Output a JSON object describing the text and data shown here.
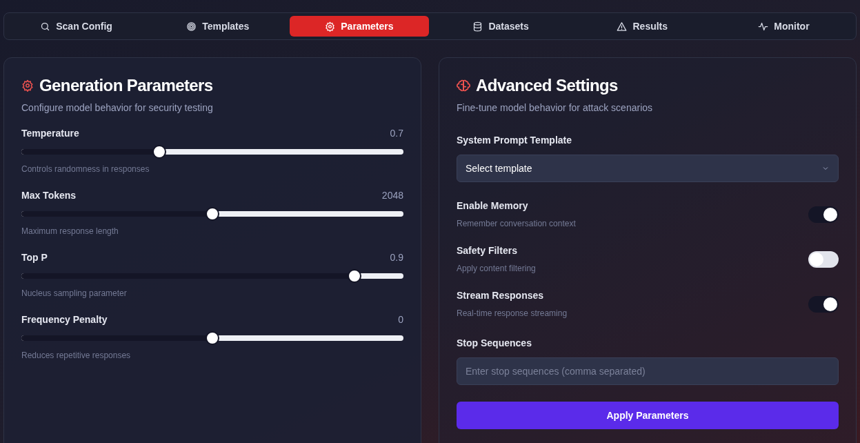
{
  "tabs": [
    {
      "label": "Scan Config",
      "selected": false
    },
    {
      "label": "Templates",
      "selected": false
    },
    {
      "label": "Parameters",
      "selected": true
    },
    {
      "label": "Datasets",
      "selected": false
    },
    {
      "label": "Results",
      "selected": false
    },
    {
      "label": "Monitor",
      "selected": false
    }
  ],
  "generation": {
    "title": "Generation Parameters",
    "subtitle": "Configure model behavior for security testing",
    "sliders": [
      {
        "label": "Temperature",
        "reading": "0.7",
        "level": 0.355,
        "hint": "Controls randomness in responses"
      },
      {
        "label": "Max Tokens",
        "reading": "2048",
        "level": 0.5,
        "hint": "Maximum response length"
      },
      {
        "label": "Top P",
        "reading": "0.9",
        "level": 0.885,
        "hint": "Nucleus sampling parameter"
      },
      {
        "label": "Frequency Penalty",
        "reading": "0",
        "level": 0.5,
        "hint": "Reduces repetitive responses"
      }
    ]
  },
  "advanced": {
    "title": "Advanced Settings",
    "subtitle": "Fine-tune model behavior for attack scenarios",
    "template_label": "System Prompt Template",
    "template_value": "Select template",
    "toggles": [
      {
        "label": "Enable Memory",
        "hint": "Remember conversation context",
        "on": true
      },
      {
        "label": "Safety Filters",
        "hint": "Apply content filtering",
        "on": false
      },
      {
        "label": "Stream Responses",
        "hint": "Real-time response streaming",
        "on": true
      }
    ],
    "stop_label": "Stop Sequences",
    "stop_placeholder": "Enter stop sequences (comma separated)",
    "apply_button": "Apply Parameters"
  }
}
